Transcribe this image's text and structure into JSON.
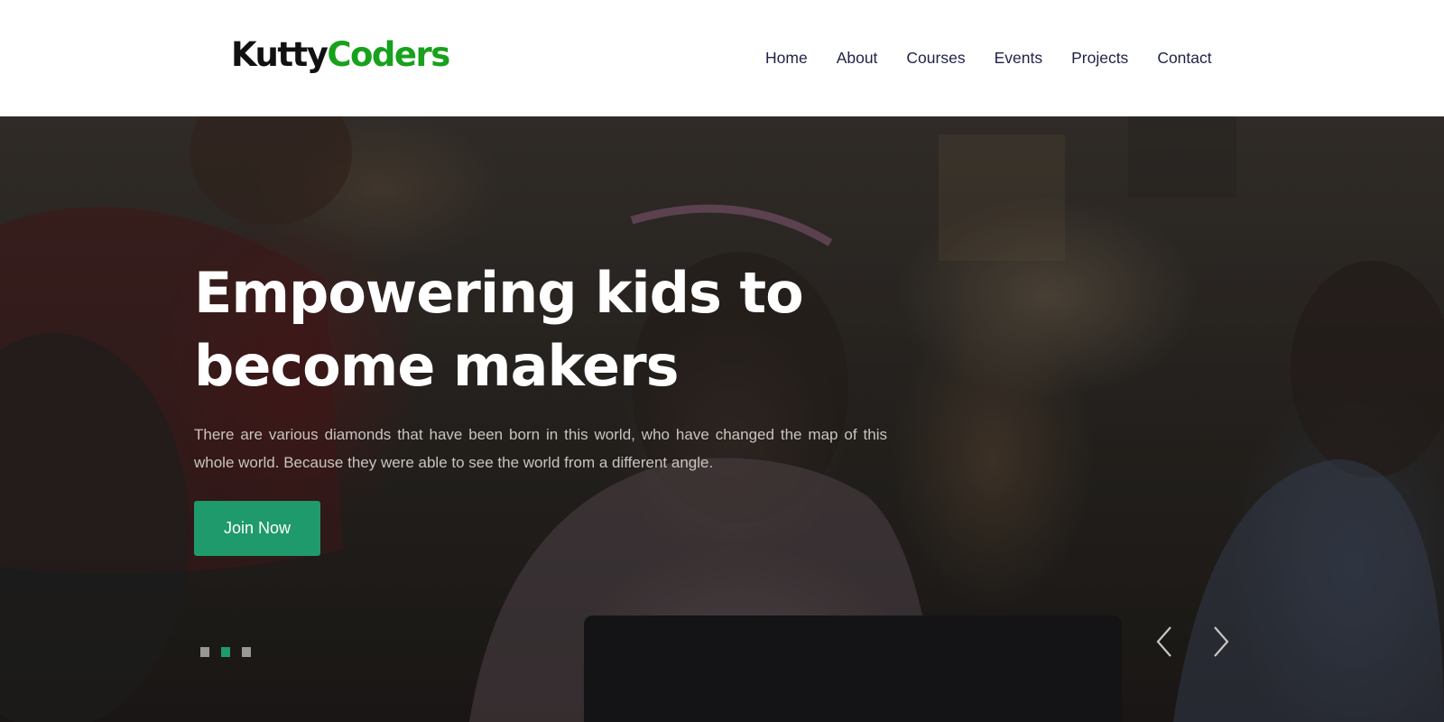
{
  "logo": {
    "part1": "Kutty",
    "part2": "Coders"
  },
  "nav": {
    "items": [
      {
        "label": "Home"
      },
      {
        "label": "About"
      },
      {
        "label": "Courses"
      },
      {
        "label": "Events"
      },
      {
        "label": "Projects"
      },
      {
        "label": "Contact"
      }
    ]
  },
  "hero": {
    "title_line1": "Empowering kids to",
    "title_line2": "become makers",
    "text": "There are various diamonds that have been born in this world, who have changed the map of this whole world. Because they were able to see the world from a different angle.",
    "cta_label": "Join Now",
    "slider": {
      "slide_count": 3,
      "active_slide": 2
    },
    "prev_icon": "chevron-left-icon",
    "next_icon": "chevron-right-icon"
  },
  "colors": {
    "brand_dark": "#111111",
    "brand_green": "#18a11c",
    "nav_text": "#1e2246",
    "accent": "#1f9a6d",
    "dot_inactive": "#9b9894"
  }
}
